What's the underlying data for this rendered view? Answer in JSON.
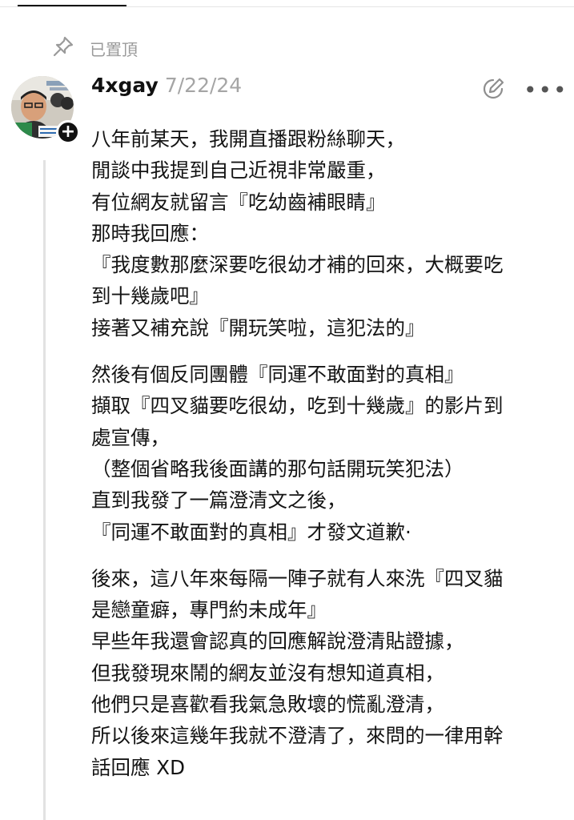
{
  "pinned": {
    "icon": "pin-icon",
    "label": "已置頂"
  },
  "post": {
    "username": "4xgay",
    "date": "7/22/24",
    "avatar_icon": "user-avatar",
    "follow_icon": "plus-icon",
    "actions": {
      "edit_icon": "edit-icon",
      "more_icon": "more-icon",
      "more_glyph": "•••"
    },
    "paragraphs": [
      {
        "lines": [
          "八年前某天，我開直播跟粉絲聊天，",
          "閒談中我提到自己近視非常嚴重，",
          "有位網友就留言『吃幼齒補眼睛』",
          "那時我回應：",
          "『我度數那麼深要吃很幼才補的回來，大概要吃",
          "到十幾歲吧』",
          "接著又補充說『開玩笑啦，這犯法的』"
        ]
      },
      {
        "lines": [
          "然後有個反同團體『同運不敢面對的真相』",
          "擷取『四叉貓要吃很幼，吃到十幾歲』的影片到",
          "處宣傳，",
          "（整個省略我後面講的那句話開玩笑犯法）",
          "直到我發了一篇澄清文之後，",
          "『同運不敢面對的真相』才發文道歉·"
        ]
      },
      {
        "lines": [
          "後來，這八年來每隔一陣子就有人來洗『四叉貓",
          "是戀童癖，專門約未成年』",
          "早些年我還會認真的回應解說澄清貼證據，",
          "但我發現來鬧的網友並沒有想知道真相，",
          "他們只是喜歡看我氣急敗壞的慌亂澄清，",
          "所以後來這幾年我就不澄清了，來問的一律用幹",
          "話回應 XD"
        ]
      }
    ]
  }
}
